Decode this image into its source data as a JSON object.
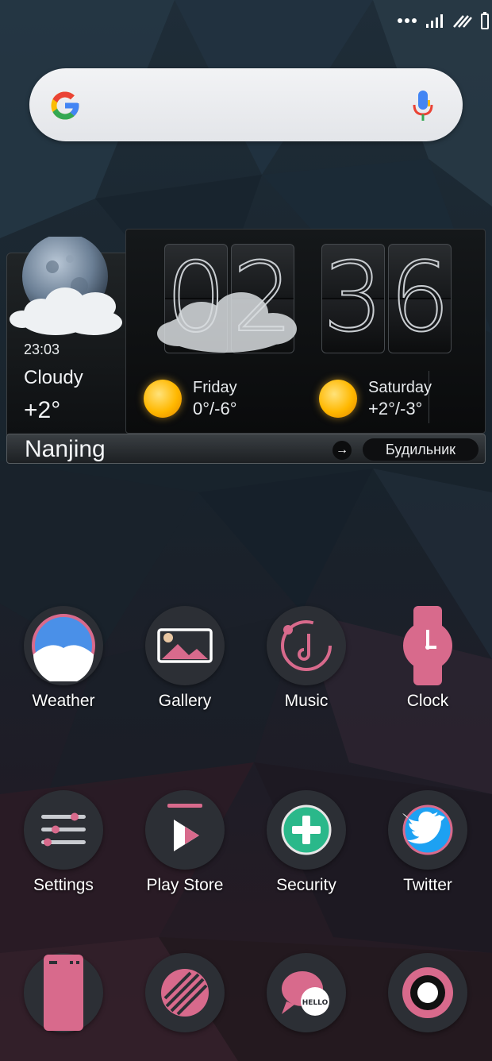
{
  "status_bar": {
    "icons": [
      "more-dots-icon",
      "signal-icon",
      "signal-slashed-icon",
      "battery-icon"
    ]
  },
  "search": {
    "logo": "google-g-icon",
    "mic_icon": "microphone-icon",
    "colors": {
      "blue": "#4285F4",
      "red": "#EA4335",
      "yellow": "#FBBC05",
      "green": "#34A853"
    }
  },
  "weather_widget": {
    "clock_hours": [
      "0",
      "2"
    ],
    "clock_minutes": [
      "3",
      "6"
    ],
    "updated_time": "23:03",
    "condition": "Cloudy",
    "temperature": "+2°",
    "city": "Nanjing",
    "alarm_label": "Будильник",
    "forecast": [
      {
        "day": "Friday",
        "range": "0°/-6°",
        "icon": "sun-icon"
      },
      {
        "day": "Saturday",
        "range": "+2°/-3°",
        "icon": "sun-icon"
      }
    ]
  },
  "apps": [
    {
      "label": "Weather",
      "icon": "weather-icon"
    },
    {
      "label": "Gallery",
      "icon": "gallery-icon"
    },
    {
      "label": "Music",
      "icon": "music-icon"
    },
    {
      "label": "Clock",
      "icon": "clock-icon"
    },
    {
      "label": "Settings",
      "icon": "settings-icon"
    },
    {
      "label": "Play Store",
      "icon": "play-store-icon"
    },
    {
      "label": "Security",
      "icon": "security-icon"
    },
    {
      "label": "Twitter",
      "icon": "twitter-icon"
    },
    {
      "label": "",
      "icon": "file-manager-icon"
    },
    {
      "label": "",
      "icon": "browser-icon"
    },
    {
      "label": "",
      "icon": "messaging-icon",
      "badge_text": "HELLO"
    },
    {
      "label": "",
      "icon": "camera-icon"
    }
  ],
  "theme": {
    "accent": "#D86A8C",
    "icon_background": "#2C2F35"
  }
}
